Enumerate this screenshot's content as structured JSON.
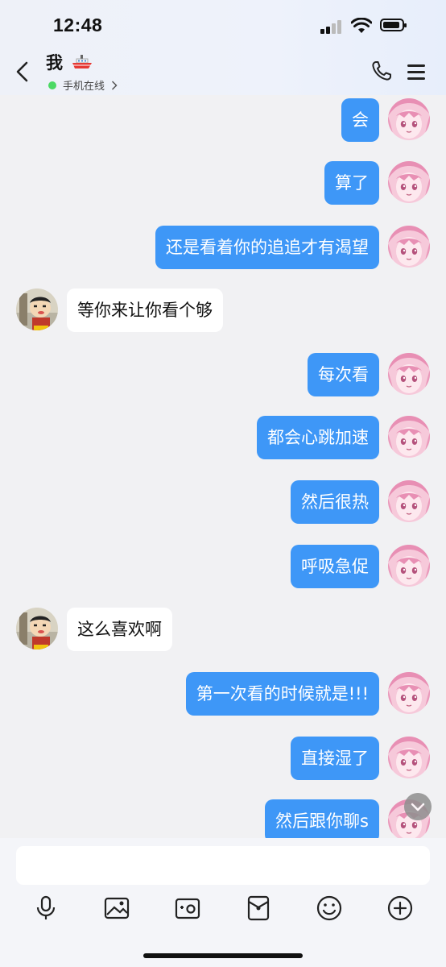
{
  "status": {
    "time": "12:48"
  },
  "header": {
    "title": "我",
    "presence": "手机在线"
  },
  "messages": [
    {
      "side": "me",
      "text": "会"
    },
    {
      "side": "me",
      "text": "算了"
    },
    {
      "side": "me",
      "text": "还是看着你的追追才有渴望"
    },
    {
      "side": "other",
      "text": "等你来让你看个够"
    },
    {
      "side": "me",
      "text": "每次看"
    },
    {
      "side": "me",
      "text": "都会心跳加速"
    },
    {
      "side": "me",
      "text": "然后很热"
    },
    {
      "side": "me",
      "text": "呼吸急促"
    },
    {
      "side": "other",
      "text": "这么喜欢啊"
    },
    {
      "side": "me",
      "text": "第一次看的时候就是!!!"
    },
    {
      "side": "me",
      "text": "直接湿了"
    },
    {
      "side": "me",
      "text": "然后跟你聊s"
    }
  ],
  "composer": {
    "placeholder": ""
  },
  "toolbar": [
    "microphone-icon",
    "image-icon",
    "camera-icon",
    "red-packet-icon",
    "emoji-icon",
    "plus-icon"
  ],
  "colors": {
    "bubble_me": "#3e97f7",
    "bubble_other": "#ffffff",
    "online": "#4cd964"
  }
}
